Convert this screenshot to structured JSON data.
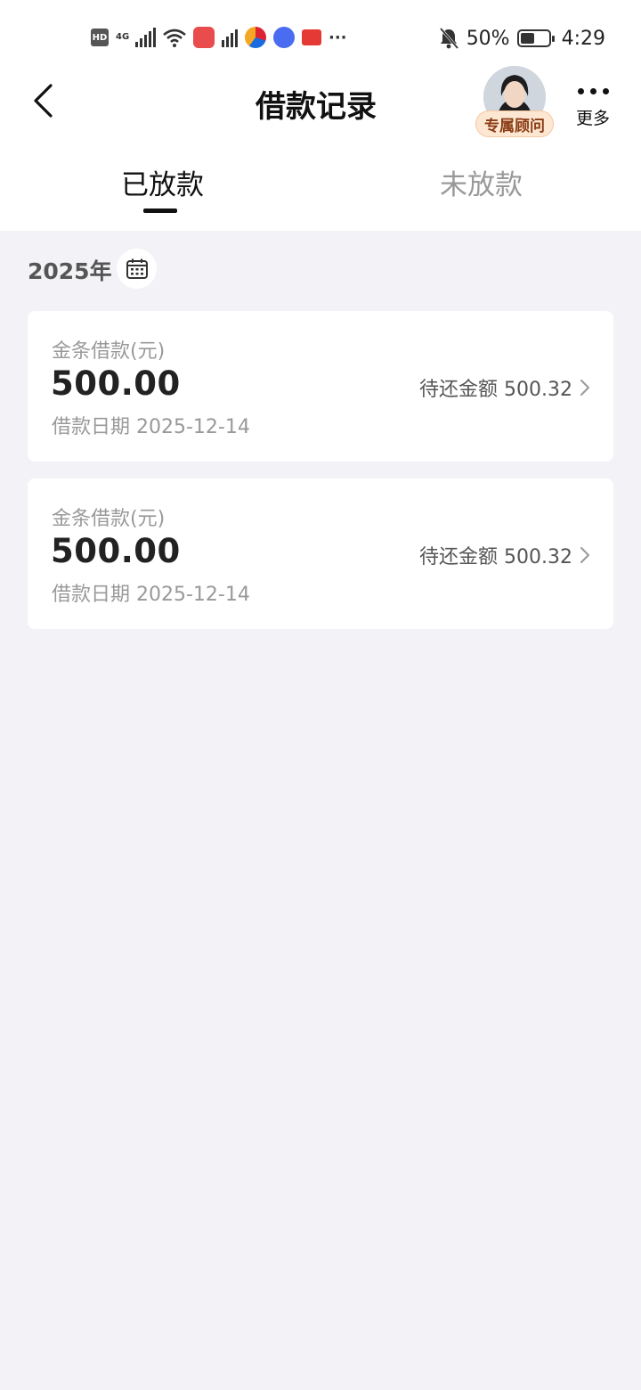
{
  "status_bar": {
    "left_icons": [
      "hd-icon",
      "4g-signal-icon",
      "wifi-icon",
      "huawei-store-icon",
      "signal-icon",
      "browser-icon",
      "music-icon",
      "book-icon",
      "more-icon"
    ],
    "network_label": "4G",
    "hd_label": "HD",
    "battery": "50%",
    "time": "4:29"
  },
  "header": {
    "title": "借款记录",
    "advisor_label": "专属顾问",
    "more_label": "更多"
  },
  "tabs": [
    {
      "label": "已放款",
      "active": true
    },
    {
      "label": "未放款",
      "active": false
    }
  ],
  "year_label": "2025年",
  "records": [
    {
      "product": "金条借款(元)",
      "amount": "500.00",
      "date": "借款日期 2025-12-14",
      "due": "待还金额 500.32"
    },
    {
      "product": "金条借款(元)",
      "amount": "500.00",
      "date": "借款日期 2025-12-14",
      "due": "待还金额 500.32"
    }
  ],
  "colors": {
    "background": "#f2f2f7",
    "card": "#ffffff",
    "badge_bg": "#fde7d2",
    "badge_text": "#8a3c14"
  }
}
